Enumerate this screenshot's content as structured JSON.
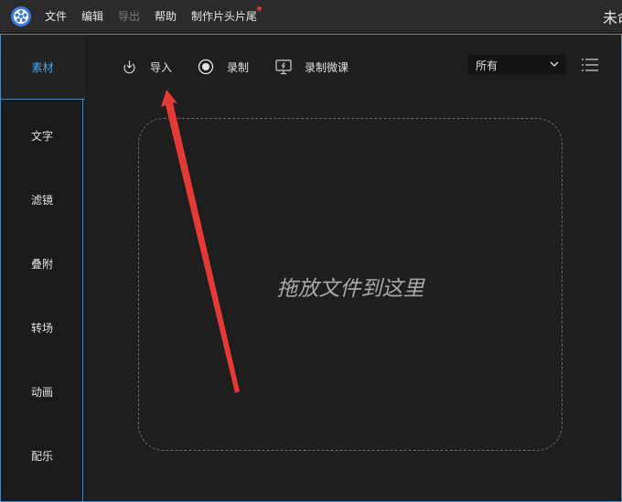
{
  "menubar": {
    "items": [
      {
        "label": "文件",
        "enabled": true
      },
      {
        "label": "编辑",
        "enabled": true
      },
      {
        "label": "导出",
        "enabled": false
      },
      {
        "label": "帮助",
        "enabled": true
      },
      {
        "label": "制作片头片尾",
        "enabled": true,
        "badge": "new-dot"
      }
    ],
    "window_title": "未命"
  },
  "sidebar": {
    "items": [
      {
        "label": "素材",
        "active": true
      },
      {
        "label": "文字"
      },
      {
        "label": "滤镜"
      },
      {
        "label": "叠附"
      },
      {
        "label": "转场"
      },
      {
        "label": "动画"
      },
      {
        "label": "配乐"
      }
    ]
  },
  "toolbar": {
    "import_label": "导入",
    "import_icon": "import-icon",
    "record_label": "录制",
    "record_icon": "record-icon",
    "record_lesson_label": "录制微课",
    "record_lesson_icon": "screen-record-icon",
    "filter_value": "所有",
    "view_toggle_icon": "list-view-icon"
  },
  "dropzone": {
    "hint": "拖放文件到这里"
  },
  "colors": {
    "accent": "#4aa3e8",
    "frame_border": "#4b86b7",
    "annotation_arrow": "#e53935",
    "badge": "#e0322b"
  }
}
